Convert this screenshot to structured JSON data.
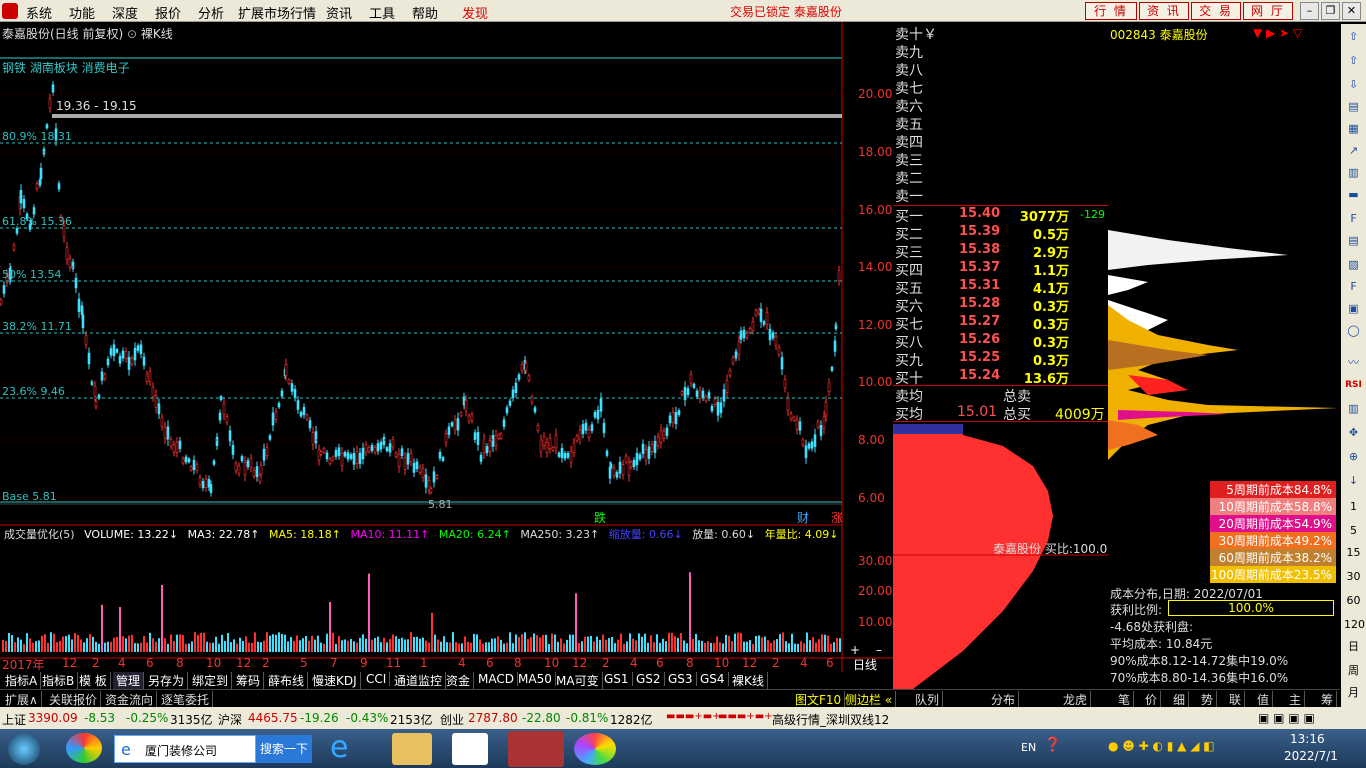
{
  "menu": {
    "items": [
      "系统",
      "功能",
      "深度",
      "报价",
      "分析",
      "扩展市场行情",
      "资讯",
      "工具",
      "帮助",
      "发现"
    ]
  },
  "lock_status": "交易已锁定  泰嘉股份",
  "top_buttons": [
    "行 情",
    "资 讯",
    "交 易",
    "网 厅"
  ],
  "chart": {
    "title": "泰嘉股份(日线 前复权)",
    "mode": "裸K线",
    "sectors": "钢铁 湖南板块 消费电子",
    "fib": {
      "top": "19.36 - 19.15",
      "f809": "80.9% 18.31",
      "f618": "61.8% 15.36",
      "f50": "50% 13.54",
      "f382": "38.2% 11.71",
      "f236": "23.6% 9.46",
      "base": "Base 5.81",
      "low": "5.81"
    },
    "yticks": [
      "20.00",
      "18.00",
      "16.00",
      "14.00",
      "12.00",
      "10.00",
      "8.00",
      "6.00"
    ],
    "marks": [
      "跌",
      "财",
      "涨"
    ]
  },
  "volume": {
    "name": "成交量优化(5)",
    "vol": "VOLUME: 13.22↓",
    "ma3": "MA3: 22.78↑",
    "ma5": "MA5: 18.18↑",
    "ma10": "MA10: 11.11↑",
    "ma20": "MA20: 6.24↑",
    "ma250": "MA250: 3.23↑",
    "shrink": "缩放量: 0.66↓",
    "flow": "放量: 0.60↓",
    "year": "年量比: 4.09↓",
    "yticks": [
      "30.00",
      "20.00",
      "10.00"
    ]
  },
  "xaxis": [
    "2017年",
    "12",
    "2",
    "4",
    "6",
    "8",
    "10",
    "12",
    "2",
    "5",
    "7",
    "9",
    "11",
    "1",
    "4",
    "6",
    "8",
    "10",
    "12",
    "2",
    "4",
    "6",
    "8",
    "10",
    "12",
    "2",
    "4",
    "6"
  ],
  "period": "日线",
  "techtabs": [
    "指标A",
    "指标B",
    "模 板",
    "管理",
    "另存为",
    "绑定到",
    "筹码",
    "薛布线",
    "慢速KDJ",
    "CCI",
    "通道监控",
    "资金",
    "MACD",
    "MA50",
    "MA可变",
    "GS1",
    "GS2",
    "GS3",
    "GS4",
    "裸K线"
  ],
  "bottomtabs": [
    "扩展∧",
    "关联报价",
    "资金流向",
    "逐笔委托",
    "图文F10",
    "侧边栏 «",
    "队列",
    "分布",
    "龙虎",
    "笔",
    "价",
    "细",
    "势",
    "联",
    "值",
    "主",
    "筹"
  ],
  "orderbook": {
    "sells": [
      "卖十￥",
      "卖九",
      "卖八",
      "卖七",
      "卖六",
      "卖五",
      "卖四",
      "卖三",
      "卖二",
      "卖一"
    ],
    "buys": [
      {
        "l": "买一",
        "p": "15.40",
        "v": "3077万",
        "c": "-129"
      },
      {
        "l": "买二",
        "p": "15.39",
        "v": "0.5万"
      },
      {
        "l": "买三",
        "p": "15.38",
        "v": "2.9万"
      },
      {
        "l": "买四",
        "p": "15.37",
        "v": "1.1万"
      },
      {
        "l": "买五",
        "p": "15.31",
        "v": "4.1万"
      },
      {
        "l": "买六",
        "p": "15.28",
        "v": "0.3万"
      },
      {
        "l": "买七",
        "p": "15.27",
        "v": "0.3万"
      },
      {
        "l": "买八",
        "p": "15.26",
        "v": "0.3万"
      },
      {
        "l": "买九",
        "p": "15.25",
        "v": "0.3万"
      },
      {
        "l": "买十",
        "p": "15.24",
        "v": "13.6万"
      }
    ],
    "avg_sell": "卖均",
    "total_sell": "总卖",
    "avg_buy": "买均",
    "avg_buy_p": "15.01",
    "total_buy": "总买",
    "total_buy_v": "4009万",
    "dist_label": "泰嘉股份 买比:100.0"
  },
  "stock": {
    "code": "002843",
    "name": "泰嘉股份"
  },
  "cost": {
    "rows": [
      {
        "t": "5周期前成本84.8%",
        "c": "#e02020"
      },
      {
        "t": "10周期前成本58.8%",
        "c": "#f08080"
      },
      {
        "t": "20周期前成本54.9%",
        "c": "#e0108a"
      },
      {
        "t": "30周期前成本49.2%",
        "c": "#f07020"
      },
      {
        "t": "60周期前成本38.2%",
        "c": "#c08030"
      },
      {
        "t": "100周期前成本23.5%",
        "c": "#f0c000"
      }
    ],
    "date": "成本分布,日期: 2022/07/01",
    "profit_label": "获利比例:",
    "profit": "100.0%",
    "l1": "-4.68处获利盘:",
    "l2": "平均成本: 10.84元",
    "l3": "90%成本8.12-14.72集中19.0%",
    "l4": "70%成本8.80-14.36集中16.0%"
  },
  "status": {
    "sh": "上证",
    "sh_v": "3390.09",
    "sh_c": "-8.53",
    "sh_p": "-0.25%",
    "sh_a": "3135亿",
    "sz": "沪深",
    "sz_v": "4465.75",
    "sz_c": "-19.26",
    "sz_p": "-0.43%",
    "sz_a": "2153亿",
    "cy": "创业",
    "cy_v": "2787.80",
    "cy_c": "-22.80",
    "cy_p": "-0.81%",
    "cy_a": "1282亿",
    "feed": "高级行情_深圳双线12"
  },
  "taskbar": {
    "window": "厦门装修公司",
    "search": "搜索一下",
    "lang": "EN",
    "time": "13:16",
    "date": "2022/7/1"
  },
  "colors": {
    "up": "#ff3030",
    "down": "#40e0ff",
    "accent": "#ffff00"
  }
}
